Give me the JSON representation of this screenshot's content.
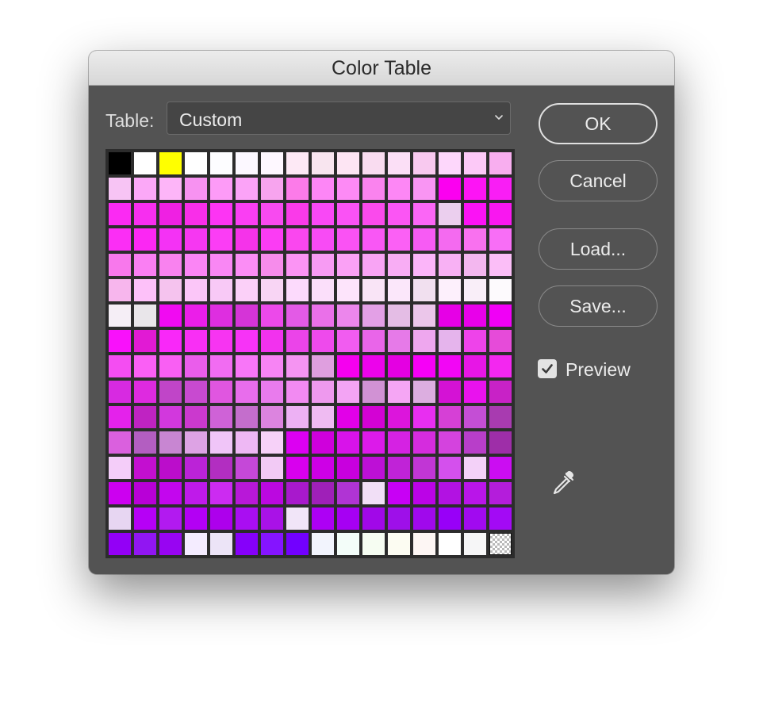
{
  "window": {
    "title": "Color Table"
  },
  "table": {
    "label": "Table:",
    "selected": "Custom",
    "icon": "chevron-down-icon"
  },
  "buttons": {
    "ok": "OK",
    "cancel": "Cancel",
    "load": "Load...",
    "save": "Save..."
  },
  "preview": {
    "label": "Preview",
    "checked": true
  },
  "tools": {
    "eyedropper_icon": "eyedropper-icon"
  },
  "swatches": [
    [
      "#000000",
      "#ffffff",
      "#ffff00",
      "#ffffff",
      "#fdfdff",
      "#fcf8ff",
      "#fef8ff",
      "#fde9f5",
      "#f8e5ef",
      "#fde5f3",
      "#f9dcf0",
      "#fbdff6",
      "#f8c9ef",
      "#fdd7fb",
      "#fcc9f7",
      "#f8aeef"
    ],
    [
      "#f7c4f4",
      "#fba8f7",
      "#fdb5f8",
      "#f792f1",
      "#fd9bf7",
      "#fba3f7",
      "#f7a4ee",
      "#fc7be9",
      "#fd86f6",
      "#fd8af5",
      "#fa83ee",
      "#fd87f5",
      "#f995f3",
      "#fb00f0",
      "#fd14f5",
      "#f91ef5"
    ],
    [
      "#fb2af3",
      "#f72ef0",
      "#ef20e3",
      "#f92ee9",
      "#fd34f4",
      "#fa3ef3",
      "#f84af0",
      "#fa3ae9",
      "#f948f6",
      "#fa52f5",
      "#fa4aec",
      "#fb55f4",
      "#fb66f6",
      "#ebcfee",
      "#fb12f5",
      "#f917f0"
    ],
    [
      "#fb2ef5",
      "#fb27f3",
      "#f432f5",
      "#f637f2",
      "#fb3df5",
      "#f533ea",
      "#fb3cf4",
      "#fa47ef",
      "#f84bf5",
      "#fa52f4",
      "#f957f5",
      "#fb60f5",
      "#f75bf4",
      "#f46af0",
      "#f971ef",
      "#f86ef6"
    ],
    [
      "#f878ec",
      "#fa7ff3",
      "#f982ef",
      "#fb85f5",
      "#f987f4",
      "#fb8df5",
      "#f68ceb",
      "#fb94f4",
      "#f79bf3",
      "#faa1f5",
      "#f8a4f4",
      "#f8adf4",
      "#fbb5f9",
      "#f8b1f4",
      "#f3b7ef",
      "#fbbef7"
    ],
    [
      "#f7b6ed",
      "#fdc1f9",
      "#f5c3ee",
      "#fbc6f8",
      "#f8c9f6",
      "#fbd0f8",
      "#f8d5f4",
      "#fcdafc",
      "#fbdffa",
      "#fde4fb",
      "#f9e4f6",
      "#fbe7fa",
      "#f1e0ef",
      "#fdf0fc",
      "#f9eef8",
      "#fdfafd"
    ],
    [
      "#f5eef6",
      "#e9e6ea",
      "#f10af2",
      "#eb1ee9",
      "#de2ee0",
      "#d534d7",
      "#ec49ea",
      "#e35ae6",
      "#ea70e9",
      "#ec86ec",
      "#e3a0e6",
      "#e4bde5",
      "#ebc6ea",
      "#e600e6",
      "#e800ea",
      "#f000f6"
    ],
    [
      "#f911fb",
      "#e11ad4",
      "#f928f9",
      "#f92ff5",
      "#f734f2",
      "#f733f7",
      "#f232ee",
      "#eb44e9",
      "#ee4aec",
      "#f15cf0",
      "#e965e9",
      "#e67ae8",
      "#eea7ee",
      "#e5b4ec",
      "#ee43ea",
      "#e64bd9"
    ],
    [
      "#f44df2",
      "#fa5ff5",
      "#f95ff3",
      "#ea5deb",
      "#f16cf2",
      "#f876f8",
      "#f784f4",
      "#f594f2",
      "#df9fdf",
      "#f500ef",
      "#ec03eb",
      "#e400e2",
      "#f600f7",
      "#f206f5",
      "#e716e6",
      "#f327f0"
    ],
    [
      "#d72ae1",
      "#de2ae0",
      "#c045c8",
      "#c84ad0",
      "#e056e0",
      "#e86dec",
      "#e97bed",
      "#f28af2",
      "#ee99ee",
      "#f3a4f4",
      "#d192d4",
      "#f5a6f4",
      "#dcaee0",
      "#d412d5",
      "#e912ee",
      "#c822c6"
    ],
    [
      "#e422eb",
      "#bf23c2",
      "#d238dd",
      "#cb39ce",
      "#cf62d7",
      "#c46ecc",
      "#dc84df",
      "#edb1f4",
      "#efbbf2",
      "#e200e8",
      "#d302d4",
      "#dc15dc",
      "#e82ef1",
      "#d640d6",
      "#c44ed5",
      "#a83bb0"
    ],
    [
      "#da60de",
      "#b35ec1",
      "#c886d2",
      "#dda3e4",
      "#f0c5f8",
      "#eeb8f4",
      "#f6d1f8",
      "#dc00f2",
      "#cf00dc",
      "#d813ea",
      "#dc1aea",
      "#d522e3",
      "#d52cde",
      "#d443de",
      "#b83ec9",
      "#9e2ea8"
    ],
    [
      "#f4cdf9",
      "#c30fd0",
      "#bb0dcb",
      "#bb23d7",
      "#b22ec1",
      "#c548d8",
      "#f2caf5",
      "#d800ee",
      "#cd00e6",
      "#c800de",
      "#bd10d6",
      "#c023d7",
      "#c136d5",
      "#d450ed",
      "#f3d1f8",
      "#cb0df2"
    ],
    [
      "#cc00f0",
      "#b800d7",
      "#c306ee",
      "#bf1aea",
      "#cc2bf1",
      "#b818d8",
      "#bb08e0",
      "#a819cc",
      "#9f20b8",
      "#b034d4",
      "#f1dff6",
      "#c800f5",
      "#bb03e7",
      "#b212e2",
      "#b915e9",
      "#b41ddb"
    ],
    [
      "#e7d6f2",
      "#b600f6",
      "#b21af0",
      "#b300f4",
      "#ad00ec",
      "#a90ef2",
      "#a912e7",
      "#f1e5f8",
      "#ad00f5",
      "#a600f3",
      "#a108e8",
      "#9e10e9",
      "#a009ec",
      "#9800f8",
      "#a10af0",
      "#a30af5"
    ],
    [
      "#9300f6",
      "#9116f2",
      "#9805f2",
      "#f4ecff",
      "#ece4f7",
      "#8600fa",
      "#8514ff",
      "#7200ff",
      "#f2f4fd",
      "#f3fdf9",
      "#f6fdf2",
      "#fcfcf2",
      "#fdf6f4",
      "#ffffff",
      "#f6f6f7",
      "transparent"
    ]
  ]
}
